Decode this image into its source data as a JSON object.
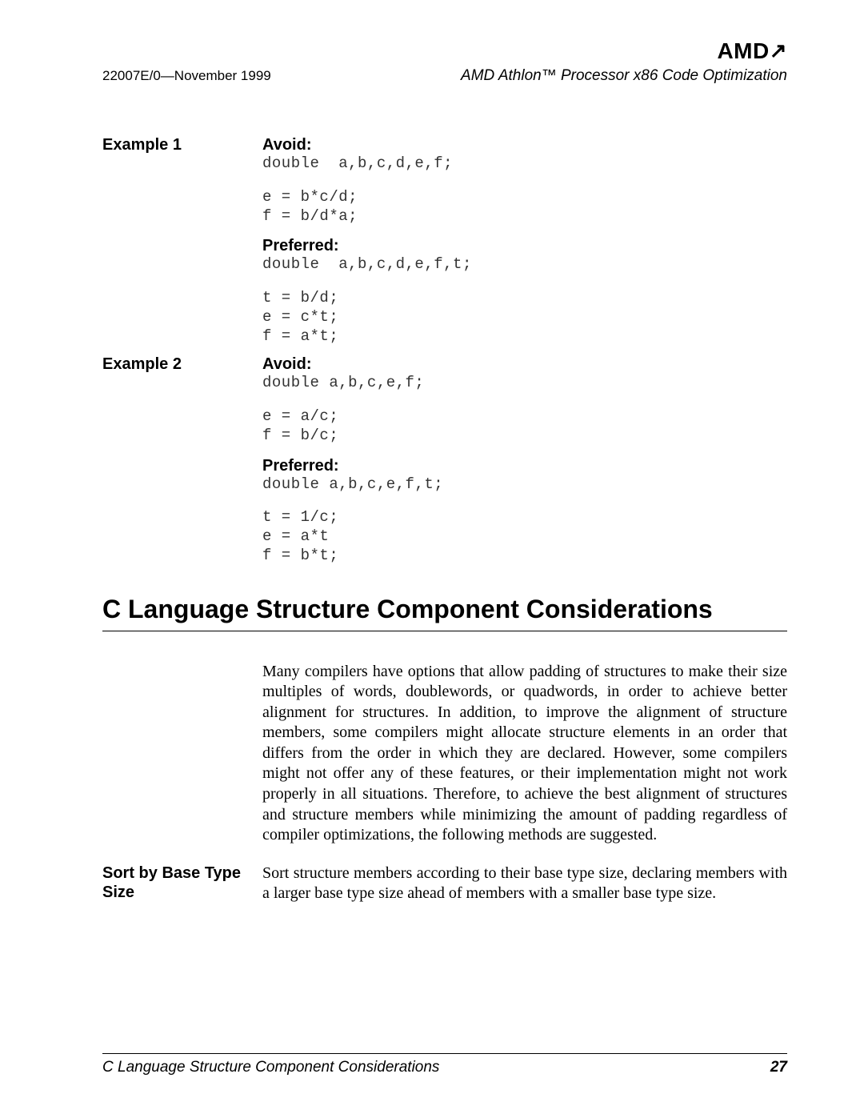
{
  "brand": "AMD",
  "header": {
    "doc_id": "22007E/0—November 1999",
    "doc_title": "AMD Athlon™ Processor x86 Code Optimization"
  },
  "example1": {
    "label": "Example 1",
    "avoid_head": "Avoid:",
    "avoid_code1": "double  a,b,c,d,e,f;",
    "avoid_code2": "e = b*c/d;\nf = b/d*a;",
    "pref_head": "Preferred:",
    "pref_code1": "double  a,b,c,d,e,f,t;",
    "pref_code2": "t = b/d;\ne = c*t;\nf = a*t;"
  },
  "example2": {
    "label": "Example 2",
    "avoid_head": "Avoid:",
    "avoid_code1": "double a,b,c,e,f;",
    "avoid_code2": "e = a/c;\nf = b/c;",
    "pref_head": "Preferred:",
    "pref_code1": "double a,b,c,e,f,t;",
    "pref_code2": "t = 1/c;\ne = a*t\nf = b*t;"
  },
  "section": {
    "title": "C Language Structure Component Considerations",
    "intro": "Many compilers have options that allow padding of structures to make their size multiples of words, doublewords, or quadwords, in order to achieve better alignment for structures. In addition, to improve the alignment of structure members, some compilers might allocate structure elements in an order that differs from the order in which they are declared. However, some compilers might not offer any of these features, or their implementation might not work properly in all situations. Therefore, to achieve the best alignment of structures and structure members while minimizing the amount of padding regardless of compiler optimizations, the following methods are suggested.",
    "sort_label": "Sort by Base Type Size",
    "sort_body": "Sort structure members according to their base type size, declaring members with a larger base type size ahead of members with a smaller base type size."
  },
  "footer": {
    "section": "C Language Structure Component Considerations",
    "page": "27"
  }
}
